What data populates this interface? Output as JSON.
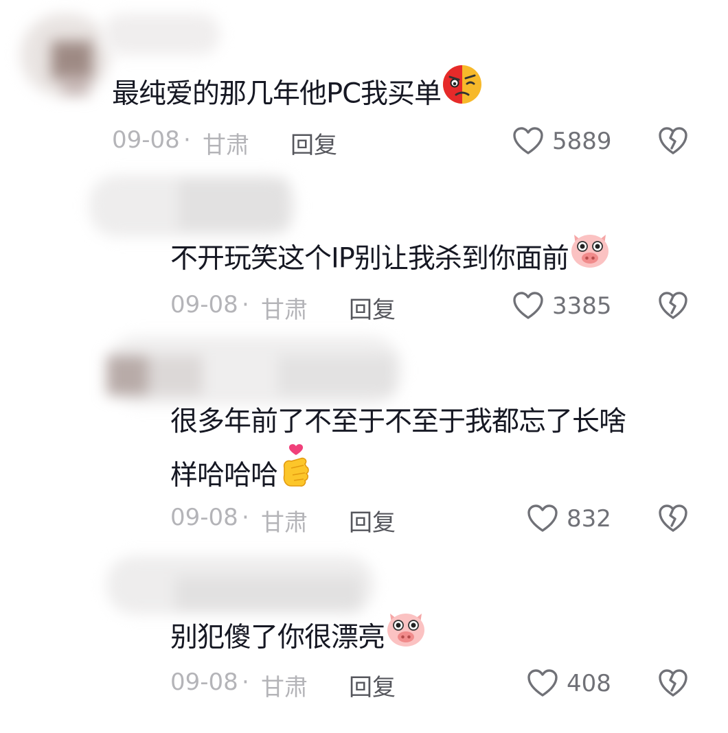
{
  "comments": [
    {
      "text": "最纯爱的那几年他PC我买单",
      "emoji": "angry-face-emoji",
      "date": "09-08",
      "separator": "·",
      "location": "甘肃",
      "reply_label": "回复",
      "likes": "5889"
    },
    {
      "text": "不开玩笑这个IP别让我杀到你面前",
      "emoji": "pig-face-emoji",
      "date": "09-08",
      "separator": "·",
      "location": "甘肃",
      "reply_label": "回复",
      "likes": "3385"
    },
    {
      "text_line1": "很多年前了不至于不至于我都忘了长啥",
      "text_line2": "样哈哈哈",
      "emoji": "finger-heart-emoji",
      "date": "09-08",
      "separator": "·",
      "location": "甘肃",
      "reply_label": "回复",
      "likes": "832"
    },
    {
      "text": "别犯傻了你很漂亮",
      "emoji": "pig-face-emoji",
      "date": "09-08",
      "separator": "·",
      "location": "甘肃",
      "reply_label": "回复",
      "likes": "408"
    }
  ],
  "icons": {
    "like": "heart-outline-icon",
    "dislike": "broken-heart-icon"
  },
  "colors": {
    "text": "#161823",
    "meta": "#b4b4b8",
    "reply": "#55565c",
    "icon": "#707177"
  }
}
